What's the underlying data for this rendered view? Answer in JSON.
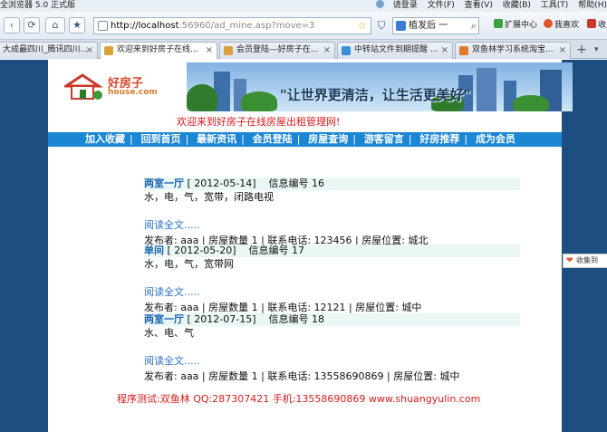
{
  "window": {
    "title": "全浏览器 5.0 正式版",
    "login": "请登录",
    "menus": [
      "文件(F)",
      "查看(V)",
      "收藏(B)",
      "工具(T)",
      "帮助(H)"
    ]
  },
  "toolbar": {
    "url_host": "http://localhost",
    "url_rest": ":56960/ad_mine.asp?move=3",
    "search_text": "植发后 一",
    "ext1": "扩展中心",
    "ext2": "我喜欢",
    "ext3": "收"
  },
  "tabs": [
    {
      "label": "大成最四川_腾讯四川...",
      "active": false
    },
    {
      "label": "欢迎来到好房子在线...",
      "active": true
    },
    {
      "label": "会员登陆---好房子在...",
      "active": false
    },
    {
      "label": "中转站文件到期提醒 ...",
      "active": false
    },
    {
      "label": "双鱼林学习系统淘宝...",
      "active": false
    }
  ],
  "page": {
    "logo_name": "好房子",
    "logo_domain": "house.com",
    "banner_slogan": "\"让世界更清洁，让生活更美好\"",
    "welcome": "欢迎来到好房子在线房屋出租管理网!",
    "nav": [
      "加入收藏",
      "回到首页",
      "最新资讯",
      "会员登陆",
      "房屋查询",
      "游客留言",
      "好房推荐",
      "成为会员"
    ],
    "listings": [
      {
        "title": "两室一厅",
        "date": "[ 2012-05-14]",
        "info": "信息编号 16",
        "desc": "水，电，气，宽带，闭路电视",
        "more": "阅读全文.....",
        "meta": "发布者:  aaa | 房屋数量 1 | 联系电话:  123456 | 房屋位置:  城北"
      },
      {
        "title": "单间",
        "date": "[ 2012-05-20]",
        "info": "信息编号 17",
        "desc": "水，电，气，宽带网",
        "more": "阅读全文.....",
        "meta": "发布者:  aaa | 房屋数量 1 | 联系电话:  12121 | 房屋位置:  城中"
      },
      {
        "title": "两室一厅",
        "date": "[ 2012-07-15]",
        "info": "信息编号 18",
        "desc": "水、电、气",
        "more": "阅读全文.....",
        "meta": "发布者:  aaa | 房屋数量 1 | 联系电话:  13558690869 | 房屋位置:  城中"
      }
    ],
    "footer": "程序测试:双鱼林 QQ:287307421 手机:13558690869 www.shuangyulin.com",
    "side_widget": "收集到"
  },
  "colors": {
    "nav_bar": "#1b86d3",
    "side_band": "#1c4f80",
    "accent_red": "#d31a1a",
    "listing_title": "#1a63b0"
  }
}
